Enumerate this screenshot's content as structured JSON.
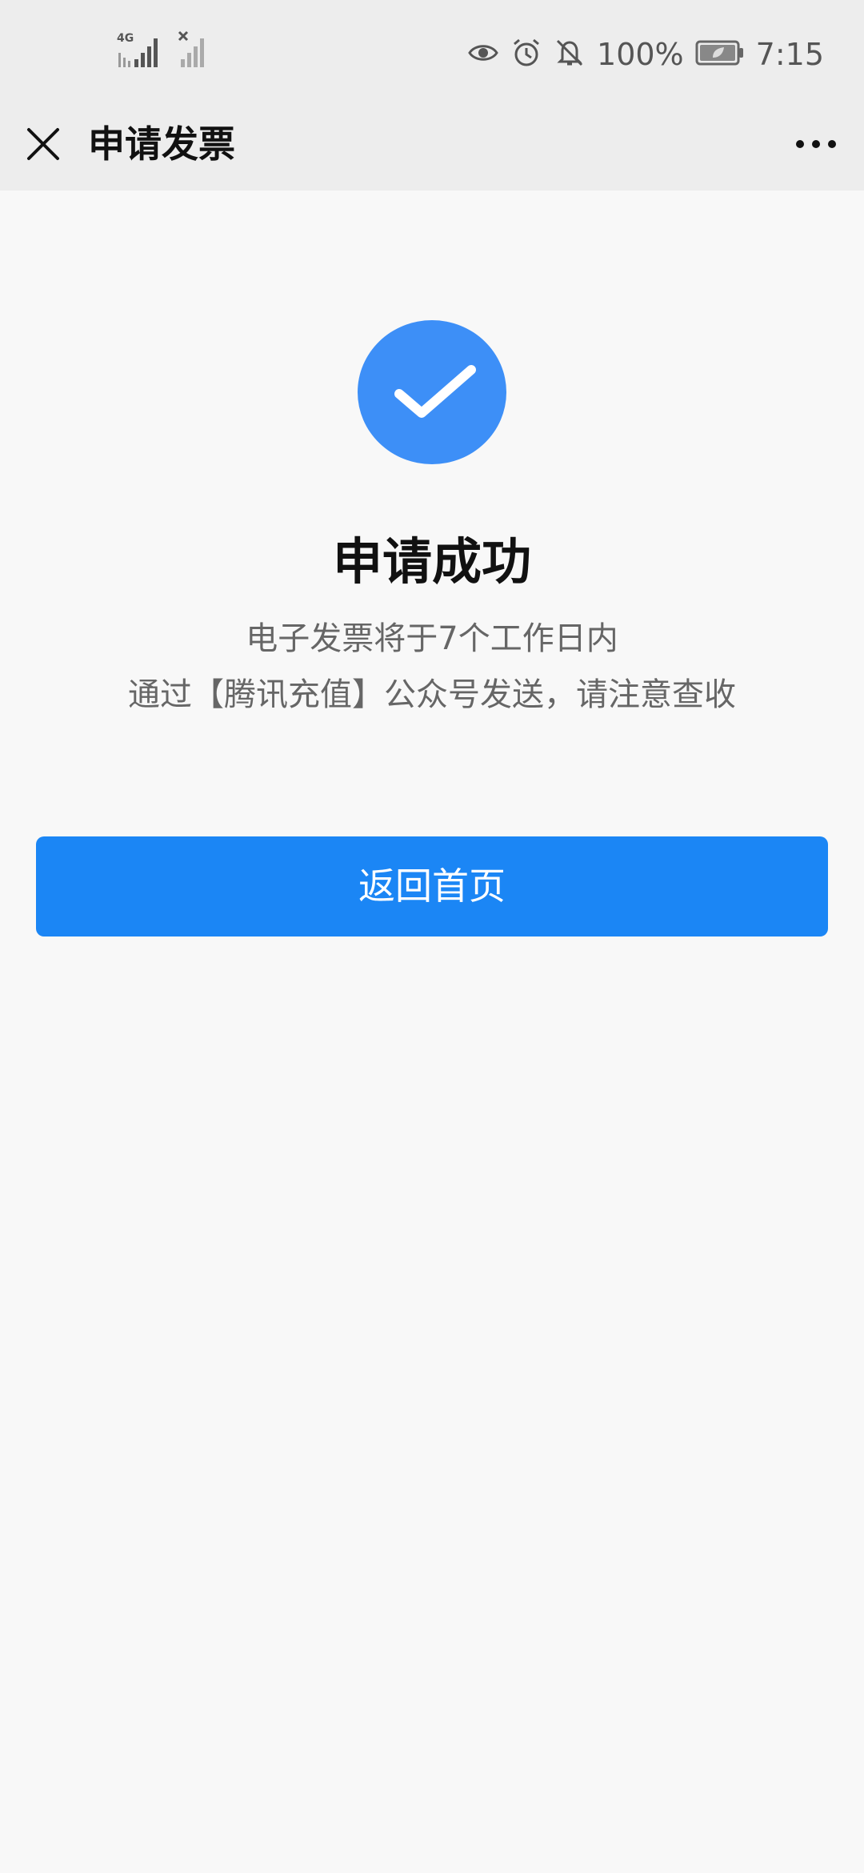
{
  "status_bar": {
    "network": "4G",
    "battery_percent": "100%",
    "time": "7:15",
    "icons": [
      "signal-4g-icon",
      "signal-no-sim-icon",
      "eye-icon",
      "alarm-icon",
      "bell-off-icon",
      "battery-icon"
    ]
  },
  "app_bar": {
    "title": "申请发票",
    "close_icon": "close-icon",
    "more_icon": "more-icon"
  },
  "result": {
    "icon": "check-circle-icon",
    "title": "申请成功",
    "line1": "电子发票将于7个工作日内",
    "line2": "通过【腾讯充值】公众号发送，请注意查收"
  },
  "actions": {
    "home_button_label": "返回首页"
  },
  "colors": {
    "accent": "#1b86f5",
    "check_circle": "#3d8ff7",
    "background": "#f8f8f8",
    "bar_background": "#ededed"
  }
}
